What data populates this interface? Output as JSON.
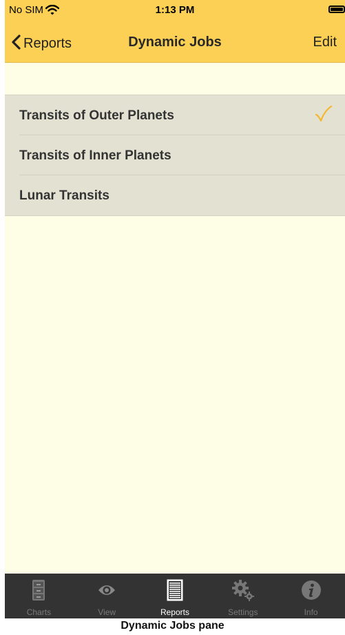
{
  "status_bar": {
    "carrier": "No SIM",
    "time": "1:13 PM"
  },
  "nav": {
    "back_label": "Reports",
    "title": "Dynamic Jobs",
    "edit_label": "Edit"
  },
  "jobs": [
    {
      "label": "Transits of Outer Planets",
      "selected": true
    },
    {
      "label": "Transits of Inner Planets",
      "selected": false
    },
    {
      "label": "Lunar Transits",
      "selected": false
    }
  ],
  "tabs": [
    {
      "label": "Charts",
      "icon": "cabinet-icon",
      "active": false
    },
    {
      "label": "View",
      "icon": "eye-icon",
      "active": false
    },
    {
      "label": "Reports",
      "icon": "document-icon",
      "active": true
    },
    {
      "label": "Settings",
      "icon": "gears-icon",
      "active": false
    },
    {
      "label": "Info",
      "icon": "info-icon",
      "active": false
    }
  ],
  "caption": "Dynamic Jobs pane",
  "colors": {
    "accent": "#fccf55",
    "background": "#fefde6",
    "list_bg": "#e3e2d2",
    "checkmark": "#f5b731",
    "tab_bar": "#333333"
  }
}
